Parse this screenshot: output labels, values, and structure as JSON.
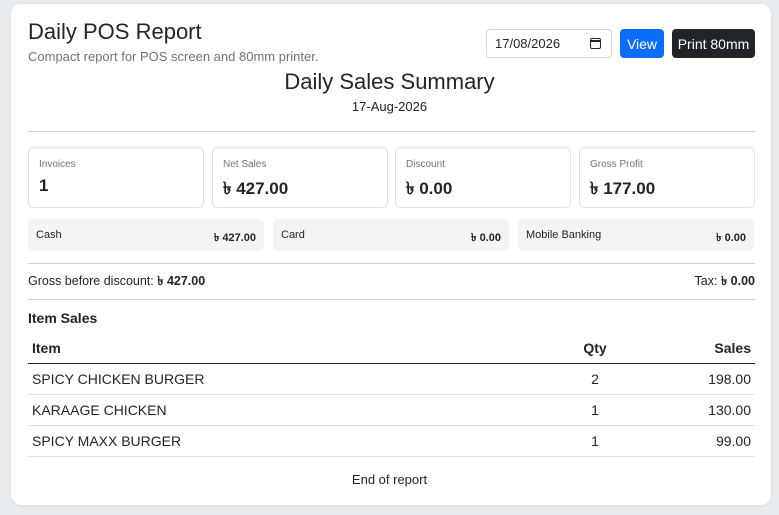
{
  "header": {
    "title": "Daily POS Report",
    "subtitle": "Compact report for POS screen and 80mm printer.",
    "date_value": "17/08/2026",
    "view_label": "View",
    "print_label": "Print 80mm"
  },
  "summary": {
    "title": "Daily Sales Summary",
    "date": "17-Aug-2026"
  },
  "stats": [
    {
      "label": "Invoices",
      "value": "1"
    },
    {
      "label": "Net Sales",
      "value": "৳ 427.00"
    },
    {
      "label": "Discount",
      "value": "৳ 0.00"
    },
    {
      "label": "Gross Profit",
      "value": "৳ 177.00"
    }
  ],
  "payments": [
    {
      "label": "Cash",
      "value": "৳ 427.00"
    },
    {
      "label": "Card",
      "value": "৳ 0.00"
    },
    {
      "label": "Mobile Banking",
      "value": "৳ 0.00"
    }
  ],
  "totals": {
    "gross_label": "Gross before discount:",
    "gross_value": "৳ 427.00",
    "tax_label": "Tax:",
    "tax_value": "৳ 0.00"
  },
  "items": {
    "title": "Item Sales",
    "headers": {
      "item": "Item",
      "qty": "Qty",
      "sales": "Sales"
    },
    "rows": [
      {
        "item": "SPICY CHICKEN BURGER",
        "qty": "2",
        "sales": "198.00"
      },
      {
        "item": "KARAAGE CHICKEN",
        "qty": "1",
        "sales": "130.00"
      },
      {
        "item": "SPICY MAXX BURGER",
        "qty": "1",
        "sales": "99.00"
      }
    ]
  },
  "footer": "End of report",
  "colors": {
    "primary": "#0d6efd",
    "dark": "#212529",
    "muted": "#6c757d"
  }
}
